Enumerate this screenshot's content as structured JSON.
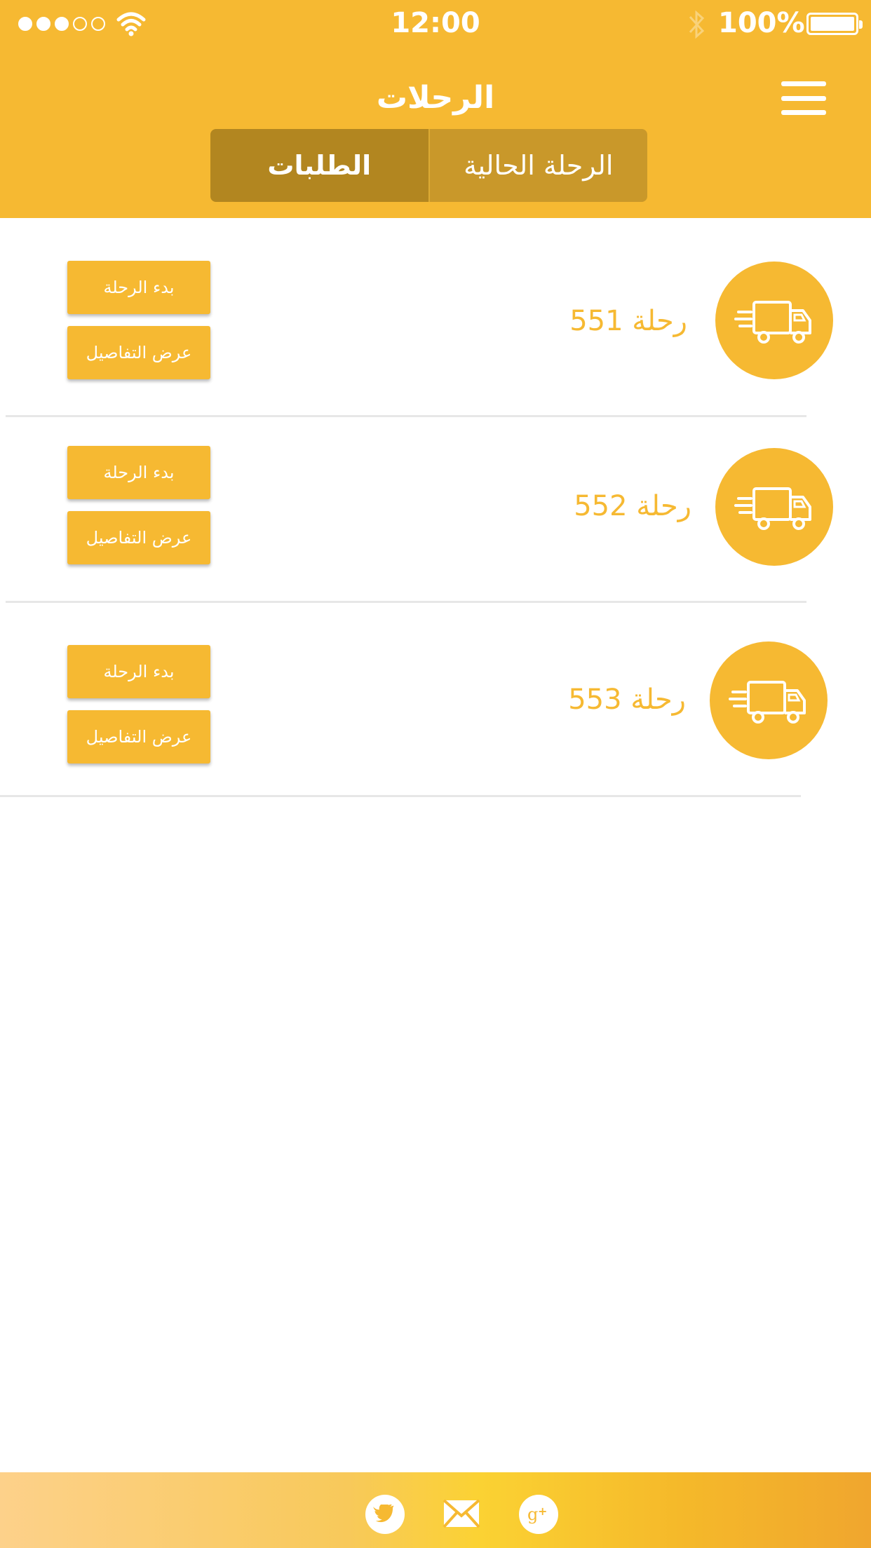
{
  "status_bar": {
    "time": "12:00",
    "battery": "100%"
  },
  "header": {
    "title": "الرحلات",
    "tabs": [
      {
        "label": "الطلبات",
        "active": true
      },
      {
        "label": "الرحلة الحالية",
        "active": false
      }
    ]
  },
  "trips": [
    {
      "label": "رحلة 551",
      "start_button": "بدء الرحلة",
      "details_button": "عرض التفاصيل"
    },
    {
      "label": "رحلة 552",
      "start_button": "بدء الرحلة",
      "details_button": "عرض التفاصيل"
    },
    {
      "label": "رحلة 553",
      "start_button": "بدء الرحلة",
      "details_button": "عرض التفاصيل"
    }
  ],
  "footer": {
    "icons": [
      "google-plus-icon",
      "mail-icon",
      "twitter-icon"
    ]
  },
  "colors": {
    "accent": "#f6b932",
    "tab_active": "#b28620",
    "tab_inactive": "#c9982a"
  }
}
